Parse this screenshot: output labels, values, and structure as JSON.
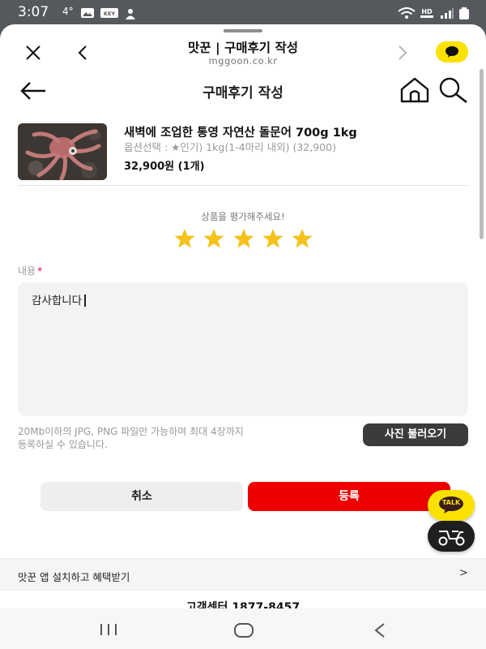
{
  "status_bar": {
    "time": "3:07",
    "temperature": "4°",
    "icons": [
      "gallery-icon",
      "key-badge-icon",
      "app-icon",
      "wifi-icon",
      "hd-voice-icon",
      "signal-icon",
      "battery-icon"
    ],
    "hd_label": "HD"
  },
  "browser_header": {
    "title": "맛꾼 | 구매후기 작성",
    "url": "mggoon.co.kr"
  },
  "page_header": {
    "title": "구매후기 작성"
  },
  "product": {
    "name": "새벽에 조업한 통영 자연산 돌문어 700g 1kg",
    "option": "옵션선택 : ★인기) 1kg(1-4마리 내외) (32,900)",
    "price": "32,900원 (1개)"
  },
  "rating": {
    "prompt": "상품을 평가해주세요!",
    "stars": 5,
    "max_stars": 5,
    "star_color": "#f5c21b"
  },
  "content": {
    "label": "내용",
    "required_mark": "*",
    "value": "감사합니다"
  },
  "upload": {
    "note_line1": "20Mb이하의 JPG, PNG 파일만 가능하며 최대 4장까지",
    "note_line2": "등록하실 수 있습니다.",
    "button_label": "사진 불러오기"
  },
  "actions": {
    "cancel_label": "취소",
    "submit_label": "등록"
  },
  "floating": {
    "talk_label": "TALK"
  },
  "banner": {
    "text": "맛꾼 앱 설치하고 혜택받기",
    "arrow": ">"
  },
  "footer": {
    "customer_center": "고객센터 1877-8457"
  },
  "colors": {
    "accent_red": "#ee0000",
    "kakao_yellow": "#fae100",
    "dark_button": "#3b3b3b"
  }
}
